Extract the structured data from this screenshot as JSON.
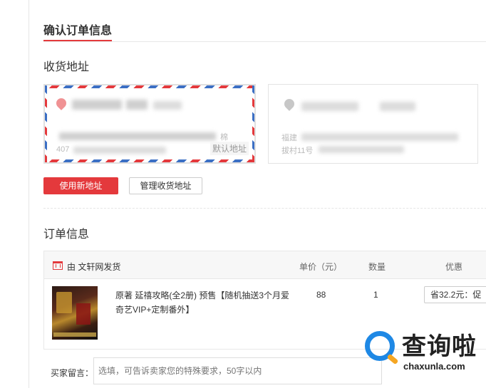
{
  "page": {
    "title": "确认订单信息"
  },
  "address": {
    "section_title": "收货地址",
    "cards": [
      {
        "line1_visible": "棉",
        "line2_visible": "407",
        "default_label": "默认地址"
      },
      {
        "line1_visible": "福建",
        "line2_visible": "拔村11号"
      }
    ],
    "new_address_button": "使用新地址",
    "manage_button": "管理收货地址"
  },
  "order": {
    "section_title": "订单信息",
    "columns": {
      "unit_price": "单价（元）",
      "quantity": "数量",
      "discount": "优惠"
    },
    "shop": {
      "prefix": "由",
      "name": "文轩网发货"
    },
    "items": [
      {
        "title": "原著 延禧攻略(全2册) 预售【随机抽送3个月爱奇艺VIP+定制番外】",
        "unit_price": "88",
        "quantity": "1",
        "discount_selected": "省32.2元：促"
      }
    ],
    "message": {
      "label": "买家留言：",
      "placeholder": "选填，可告诉卖家您的特殊要求，50字以内"
    }
  },
  "watermark": {
    "text": "查询啦",
    "sub": "chaxunla.com"
  },
  "colors": {
    "accent": "#e4393c",
    "stripe_blue": "#3b6fc4",
    "watermark_blue": "#1e88e5"
  }
}
